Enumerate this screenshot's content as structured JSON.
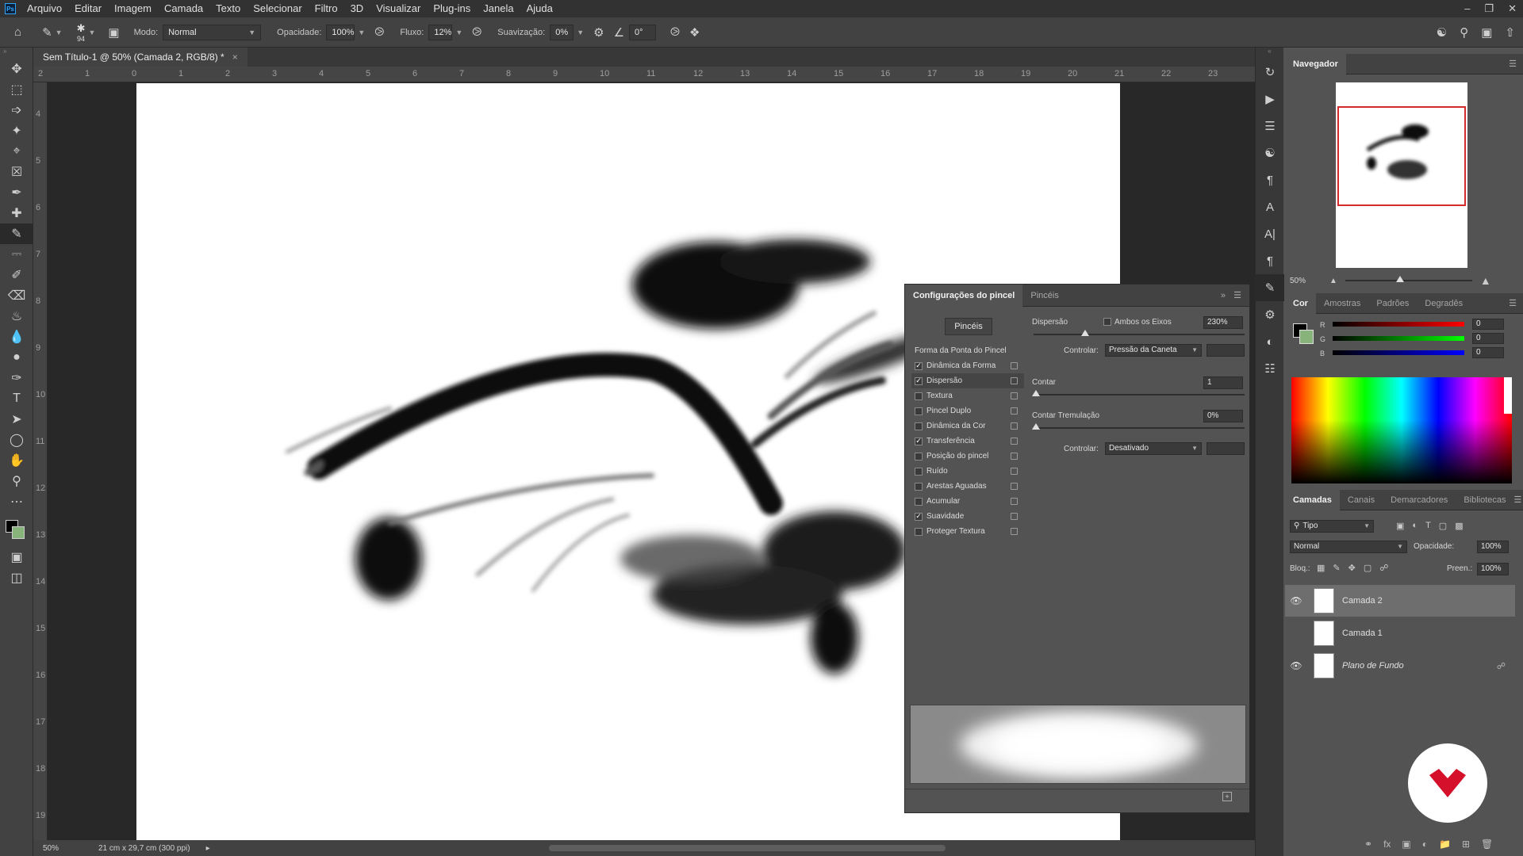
{
  "menu": {
    "logo": "Ps",
    "items": [
      "Arquivo",
      "Editar",
      "Imagem",
      "Camada",
      "Texto",
      "Selecionar",
      "Filtro",
      "3D",
      "Visualizar",
      "Plug-ins",
      "Janela",
      "Ajuda"
    ]
  },
  "options": {
    "brush_size": "94",
    "mode_label": "Modo:",
    "mode_value": "Normal",
    "opacity_label": "Opacidade:",
    "opacity_value": "100%",
    "flow_label": "Fluxo:",
    "flow_value": "12%",
    "smoothing_label": "Suavização:",
    "smoothing_value": "0%",
    "angle_value": "0°"
  },
  "document": {
    "tab_title": "Sem Título-1 @ 50% (Camada 2, RGB/8) *",
    "close_glyph": "×",
    "ruler_h": [
      "2",
      "1",
      "0",
      "1",
      "2",
      "3",
      "4",
      "5",
      "6",
      "7",
      "8",
      "9",
      "10",
      "11",
      "12",
      "13",
      "14",
      "15",
      "16",
      "17",
      "18",
      "19",
      "20",
      "21",
      "22",
      "23"
    ],
    "ruler_v": [
      "4",
      "5",
      "6",
      "7",
      "8",
      "9",
      "10",
      "11",
      "12",
      "13",
      "14",
      "15",
      "16",
      "17",
      "18",
      "19"
    ]
  },
  "status": {
    "zoom": "50%",
    "doc_size": "21 cm x 29,7 cm (300 ppi)"
  },
  "brush_panel": {
    "tab_active": "Configurações do pincel",
    "tab_other": "Pincéis",
    "pinceis_button": "Pincéis",
    "section_header": "Forma da Ponta do Pincel",
    "options": [
      {
        "label": "Dinâmica da Forma",
        "checked": true
      },
      {
        "label": "Dispersão",
        "checked": true
      },
      {
        "label": "Textura",
        "checked": false
      },
      {
        "label": "Pincel Duplo",
        "checked": false
      },
      {
        "label": "Dinâmica da Cor",
        "checked": false
      },
      {
        "label": "Transferência",
        "checked": true
      },
      {
        "label": "Posição do pincel",
        "checked": false
      },
      {
        "label": "Ruído",
        "checked": false
      },
      {
        "label": "Arestas Aguadas",
        "checked": false
      },
      {
        "label": "Acumular",
        "checked": false
      },
      {
        "label": "Suavidade",
        "checked": true
      },
      {
        "label": "Proteger Textura",
        "checked": false
      }
    ],
    "scatter_label": "Dispersão",
    "both_axes_label": "Ambos os Eixos",
    "scatter_value": "230%",
    "control_label": "Controlar:",
    "control_value": "Pressão da Caneta",
    "count_label": "Contar",
    "count_value": "1",
    "count_jitter_label": "Contar Tremulação",
    "count_jitter_value": "0%",
    "control2_label": "Controlar:",
    "control2_value": "Desativado"
  },
  "navigator": {
    "title": "Navegador",
    "zoom": "50%"
  },
  "color_panel": {
    "tabs": [
      "Cor",
      "Amostras",
      "Padrões",
      "Degradês"
    ],
    "channels": [
      {
        "name": "R",
        "value": "0"
      },
      {
        "name": "G",
        "value": "0"
      },
      {
        "name": "B",
        "value": "0"
      }
    ]
  },
  "layers_panel": {
    "tabs": [
      "Camadas",
      "Canais",
      "Demarcadores",
      "Bibliotecas"
    ],
    "filter_label": "Tipo",
    "blend_mode": "Normal",
    "opacity_label": "Opacidade:",
    "opacity_value": "100%",
    "lock_label": "Bloq.:",
    "fill_label": "Preen.:",
    "fill_value": "100%",
    "layers": [
      {
        "name": "Camada 2",
        "visible": true,
        "selected": true
      },
      {
        "name": "Camada 1",
        "visible": false,
        "selected": false
      },
      {
        "name": "Plano de Fundo",
        "visible": true,
        "selected": false,
        "locked": true
      }
    ]
  },
  "colors": {
    "accent": "#31a8ff",
    "badge_red": "#d4102a"
  }
}
